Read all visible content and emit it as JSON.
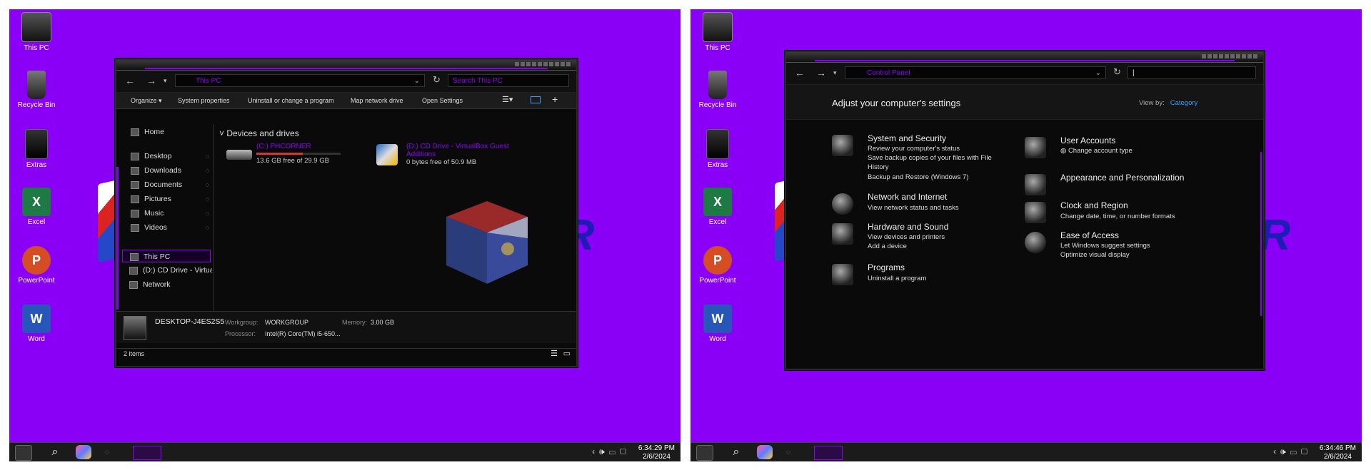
{
  "desktop": {
    "icons": [
      {
        "label": "This PC",
        "kind": "this-pc"
      },
      {
        "label": "Recycle Bin",
        "kind": "recycle-bin"
      },
      {
        "label": "Extras",
        "kind": "extras"
      },
      {
        "label": "Excel",
        "kind": "excel",
        "letter": "X"
      },
      {
        "label": "PowerPoint",
        "kind": "powerpoint",
        "letter": "P"
      },
      {
        "label": "Word",
        "kind": "word",
        "letter": "W"
      }
    ],
    "background_color": "#8a00f7",
    "background_letter": "R"
  },
  "taskbar_left": {
    "time": "6:34:29 PM",
    "date": "2/6/2024",
    "tray_icons": [
      "chevron-icon",
      "volume-icon",
      "network-icon",
      "notification-icon"
    ]
  },
  "taskbar_right": {
    "time": "6:34:46 PM",
    "date": "2/6/2024",
    "tray_icons": [
      "chevron-icon",
      "volume-icon",
      "network-icon",
      "notification-icon"
    ]
  },
  "explorer": {
    "address": "This PC",
    "search_placeholder": "Search This PC",
    "toolbar": [
      "Organize ▾",
      "System properties",
      "Uninstall or change a program",
      "Map network drive",
      "Open Settings"
    ],
    "nav": [
      {
        "label": "Home"
      },
      {
        "label": "Desktop",
        "pinned": true
      },
      {
        "label": "Downloads",
        "pinned": true
      },
      {
        "label": "Documents",
        "pinned": true
      },
      {
        "label": "Pictures",
        "pinned": true
      },
      {
        "label": "Music",
        "pinned": true
      },
      {
        "label": "Videos",
        "pinned": true
      },
      {
        "label": "This PC",
        "selected": true
      },
      {
        "label": "(D:) CD Drive - VirtualBox Guest Additions"
      },
      {
        "label": "Network"
      }
    ],
    "section_title": "Devices and drives",
    "drives": [
      {
        "name": "(C:) PHCORNER",
        "free": "13.6 GB free of 29.9 GB",
        "used_fraction": 0.55
      },
      {
        "name": "(D:) CD Drive - VirtualBox Guest Additions",
        "free": "0 bytes free of 50.9 MB"
      }
    ],
    "details": {
      "computer_name": "DESKTOP-J4ES2S5",
      "workgroup_label": "Workgroup:",
      "workgroup": "WORKGROUP",
      "memory_label": "Memory:",
      "memory": "3.00 GB",
      "processor_label": "Processor:",
      "processor": "Intel(R) Core(TM) i5-650..."
    },
    "status": "2 items"
  },
  "control_panel": {
    "address": "Control Panel",
    "heading": "Adjust your computer's settings",
    "view_by_label": "View by:",
    "view_by_value": "Category",
    "left_items": [
      {
        "title": "System and Security",
        "links": [
          "Review your computer's status",
          "Save backup copies of your files with File",
          "History",
          "Backup and Restore (Windows 7)"
        ]
      },
      {
        "title": "Network and Internet",
        "links": [
          "View network status and tasks"
        ]
      },
      {
        "title": "Hardware and Sound",
        "links": [
          "View devices and printers",
          "Add a device"
        ]
      },
      {
        "title": "Programs",
        "links": [
          "Uninstall a program"
        ]
      }
    ],
    "right_items": [
      {
        "title": "User Accounts",
        "links": [
          "Change account type"
        ]
      },
      {
        "title": "Appearance and Personalization",
        "links": []
      },
      {
        "title": "Clock and Region",
        "links": [
          "Change date, time, or number formats"
        ]
      },
      {
        "title": "Ease of Access",
        "links": [
          "Let Windows suggest settings",
          "Optimize visual display"
        ]
      }
    ]
  }
}
